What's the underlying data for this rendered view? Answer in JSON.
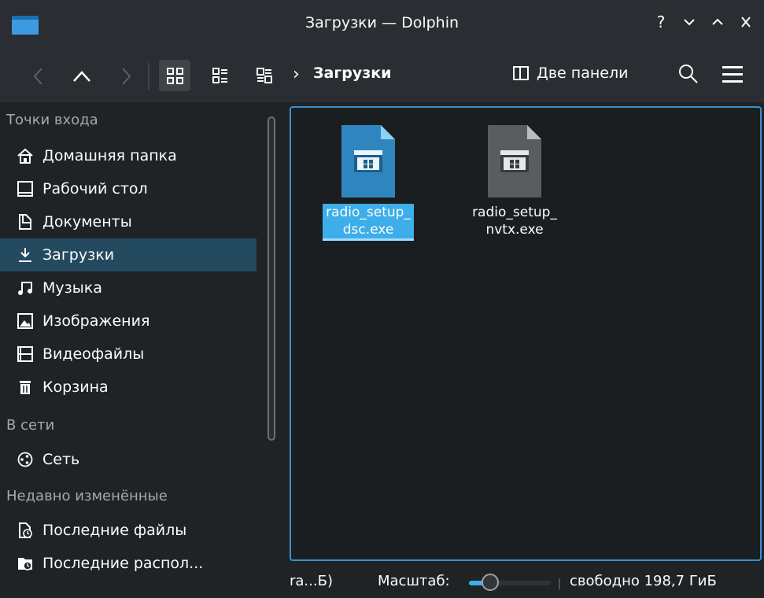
{
  "window": {
    "title": "Загрузки — Dolphin",
    "buttons": [
      "?",
      "⌄",
      "^",
      "✕"
    ]
  },
  "toolbar": {
    "breadcrumb": "Загрузки",
    "split_label": "Две панели",
    "active_view": "icons"
  },
  "sidebar": {
    "sections": [
      {
        "header": "Точки входа",
        "items": [
          {
            "label": "Домашняя папка",
            "icon": "home-icon"
          },
          {
            "label": "Рабочий стол",
            "icon": "desktop-icon"
          },
          {
            "label": "Документы",
            "icon": "documents-icon"
          },
          {
            "label": "Загрузки",
            "icon": "downloads-icon",
            "active": true
          },
          {
            "label": "Музыка",
            "icon": "music-icon"
          },
          {
            "label": "Изображения",
            "icon": "pictures-icon"
          },
          {
            "label": "Видеофайлы",
            "icon": "videos-icon"
          },
          {
            "label": "Корзина",
            "icon": "trash-icon"
          }
        ]
      },
      {
        "header": "В сети",
        "items": [
          {
            "label": "Сеть",
            "icon": "network-icon"
          }
        ]
      },
      {
        "header": "Недавно изменённые",
        "items": [
          {
            "label": "Последние файлы",
            "icon": "recent-files-icon"
          },
          {
            "label": "Последние распол...",
            "icon": "recent-locations-icon"
          }
        ]
      }
    ]
  },
  "files": [
    {
      "name_line1": "radio_setup_",
      "name_line2": "dsc.exe",
      "selected": true,
      "icon_color": "#2f86bf"
    },
    {
      "name_line1": "radio_setup_",
      "name_line2": "nvtx.exe",
      "selected": false,
      "icon_color": "#5a5d60"
    }
  ],
  "statusbar": {
    "left_text": "ra...Б)",
    "zoom_label": "Масштаб:",
    "zoom_level": 0.2,
    "free_text": "свободно 198,7 ГиБ"
  },
  "colors": {
    "accent": "#3daee9",
    "window_bg": "#202326",
    "titlebar_bg": "#2a2e32",
    "selection_bg": "#244a60"
  }
}
